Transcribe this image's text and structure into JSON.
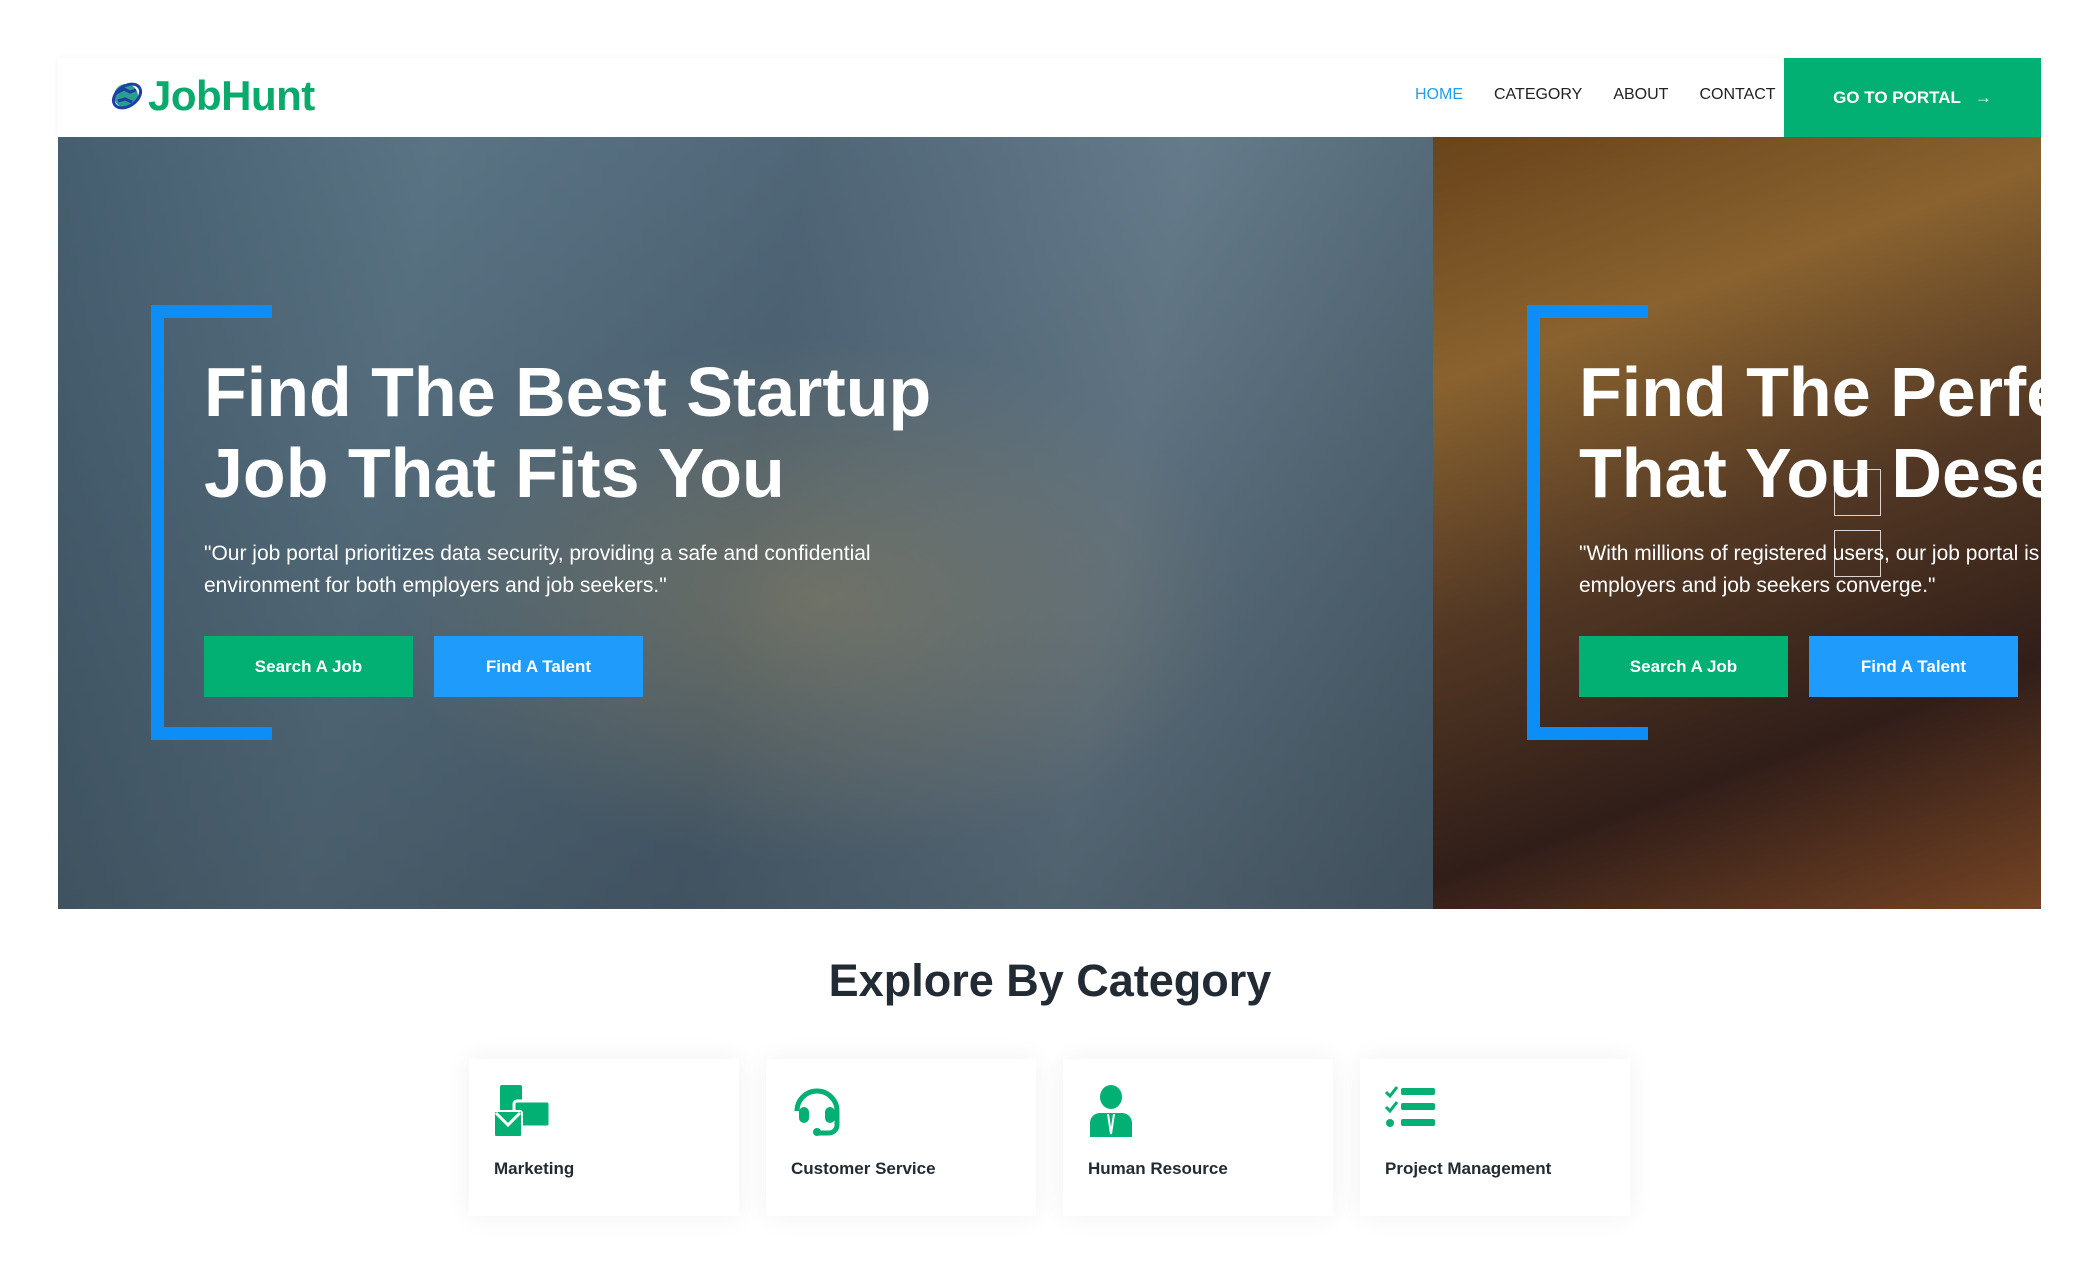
{
  "header": {
    "logo": "JobHunt",
    "nav": [
      "HOME",
      "CATEGORY",
      "ABOUT",
      "CONTACT"
    ],
    "active": "HOME",
    "portal_button": "GO TO PORTAL"
  },
  "hero": {
    "slides": [
      {
        "title_line1": "Find The Best Startup",
        "title_line2": "Job That Fits You",
        "text_line1": "\"Our job portal prioritizes data security, providing a safe and confidential",
        "text_line2": "environment for both employers and job seekers.\"",
        "btn_search": "Search A Job",
        "btn_talent": "Find A Talent"
      },
      {
        "title_line1": "Find The Perfe",
        "title_line2": "That You Dese",
        "text_line1": "\"With millions of registered users, our job portal is",
        "text_line2": "employers and job seekers converge.\"",
        "btn_search": "Search A Job",
        "btn_talent": "Find A Talent"
      }
    ]
  },
  "categories": {
    "title": "Explore By Category",
    "items": [
      {
        "label": "Marketing",
        "icon": "marketing-icon"
      },
      {
        "label": "Customer Service",
        "icon": "headset-icon"
      },
      {
        "label": "Human Resource",
        "icon": "person-tie-icon"
      },
      {
        "label": "Project Management",
        "icon": "checklist-icon"
      }
    ]
  },
  "colors": {
    "green": "#02b073",
    "blue": "#1e9bfb",
    "bracket": "#0d8ef6",
    "nav_active": "#1e9ff2"
  }
}
